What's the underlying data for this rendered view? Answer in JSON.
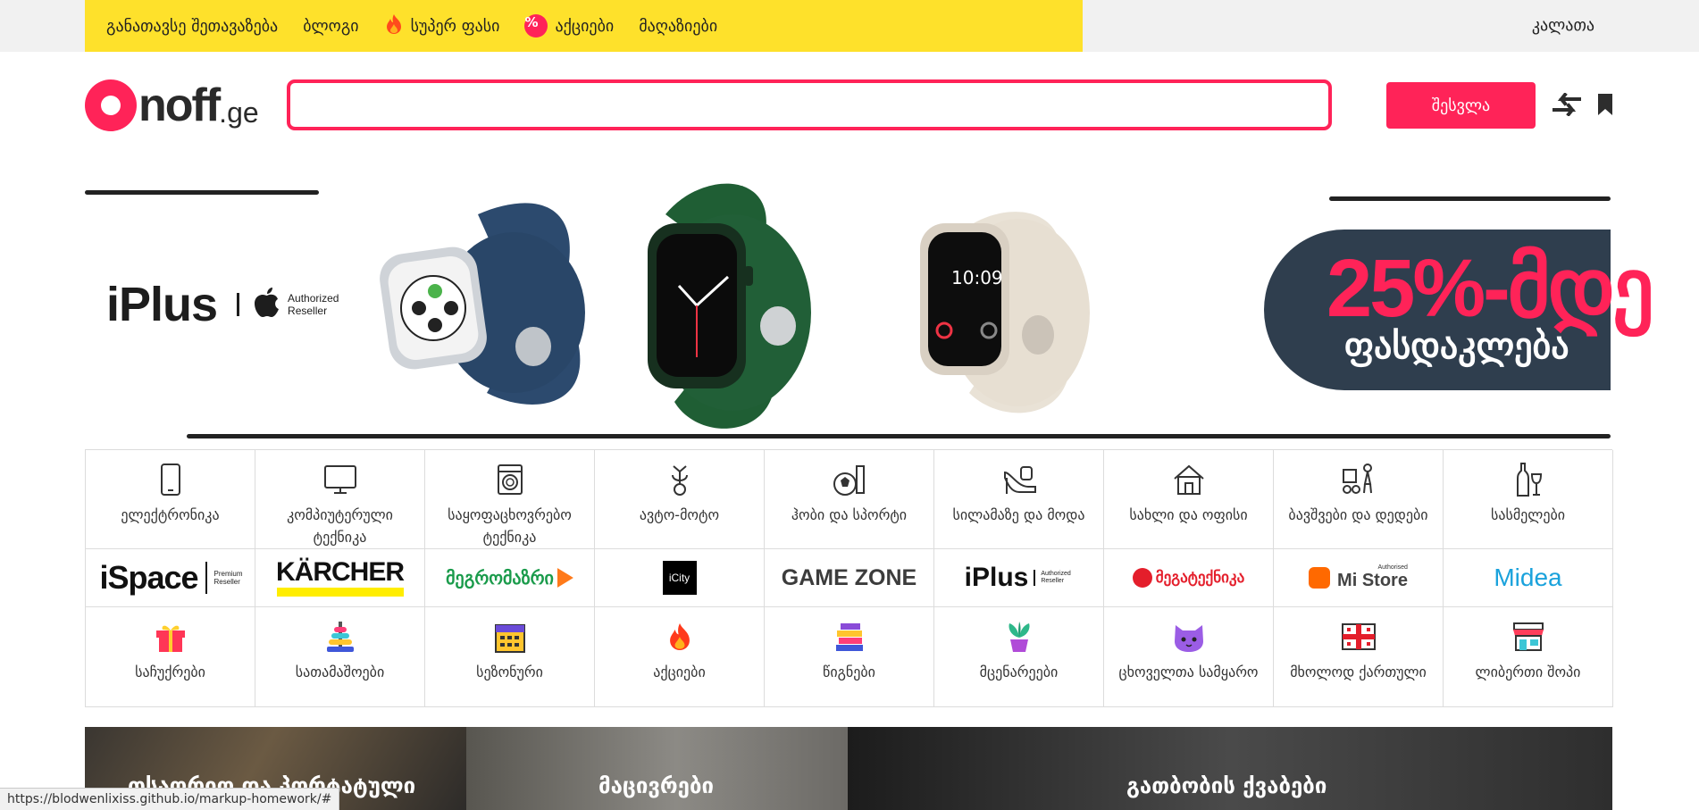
{
  "topbar": {
    "nav": [
      {
        "label": "განათავსე შეთავაზება",
        "icon": ""
      },
      {
        "label": "ბლოგი",
        "icon": ""
      },
      {
        "label": "სუპერ ფასი",
        "icon": "fire-icon"
      },
      {
        "label": "აქციები",
        "icon": "percent-badge-icon"
      },
      {
        "label": "მაღაზიები",
        "icon": ""
      }
    ],
    "percent_glyph": "%",
    "city": "კალათა"
  },
  "header": {
    "logo_main": "noff",
    "logo_suffix": ".ge",
    "search_placeholder": "",
    "login_label": "შესვლა",
    "icons": [
      "compare-arrows-icon",
      "bookmark-icon"
    ]
  },
  "banner": {
    "brand": "iPlus",
    "auth_line1": "Authorized",
    "auth_line2": "Reseller",
    "promo_big": "25%-მდე",
    "promo_small": "ფასდაკლება",
    "watch_colors": [
      "#2c4a6e",
      "#1f5e34",
      "#e9e2d6"
    ]
  },
  "categories": [
    {
      "label": "ელექტრონიკა",
      "icon": "smartphone-icon"
    },
    {
      "label": "კომპიუტერული ტექნიკა",
      "icon": "monitor-icon"
    },
    {
      "label": "საყოფაცხოვრებო ტექნიკა",
      "icon": "washing-machine-icon"
    },
    {
      "label": "ავტო-მოტო",
      "icon": "scooter-icon"
    },
    {
      "label": "ჰობი და სპორტი",
      "icon": "sports-ball-icon"
    },
    {
      "label": "სილამაზე და მოდა",
      "icon": "high-heel-icon"
    },
    {
      "label": "სახლი და ოფისი",
      "icon": "house-icon"
    },
    {
      "label": "ბავშვები და დედები",
      "icon": "stroller-icon"
    },
    {
      "label": "სასმელები",
      "icon": "bottle-glass-icon"
    }
  ],
  "brands": [
    {
      "name": "iSpace",
      "sub": "Premium Reseller"
    },
    {
      "name": "KÄRCHER",
      "sub": ""
    },
    {
      "name": "მეგრომაზრი",
      "sub": ""
    },
    {
      "name": "iCity",
      "sub": ""
    },
    {
      "name": "GAME ZONE",
      "sub": ""
    },
    {
      "name": "iPlus",
      "sub": "Authorized Reseller"
    },
    {
      "name": "მეგატექნიკა",
      "sub": ""
    },
    {
      "name": "Mi Store",
      "sub": "Authorised"
    },
    {
      "name": "Midea",
      "sub": ""
    }
  ],
  "specials": [
    {
      "label": "საჩუქრები",
      "icon": "gift-icon"
    },
    {
      "label": "სათამაშოები",
      "icon": "ring-stack-toy-icon"
    },
    {
      "label": "სეზონური",
      "icon": "calendar-icon"
    },
    {
      "label": "აქციები",
      "icon": "fire-icon"
    },
    {
      "label": "წიგნები",
      "icon": "books-icon"
    },
    {
      "label": "მცენარეები",
      "icon": "potted-plant-icon"
    },
    {
      "label": "ცხოველთა სამყარო",
      "icon": "cat-icon"
    },
    {
      "label": "მხოლოდ ქართული",
      "icon": "georgian-flag-icon"
    },
    {
      "label": "ლიბერთი შოპი",
      "icon": "shop-icon"
    }
  ],
  "tiles": [
    {
      "label": "თსაორიო და პორტატული"
    },
    {
      "label": "მაცივრები"
    },
    {
      "label": "გათბობის ქვაბები"
    }
  ],
  "status_url": "https://blodwenlixiss.github.io/markup-homework/#",
  "colors": {
    "accent": "#ff2358",
    "yellow": "#fee12b",
    "navy": "#2f3e4e"
  }
}
